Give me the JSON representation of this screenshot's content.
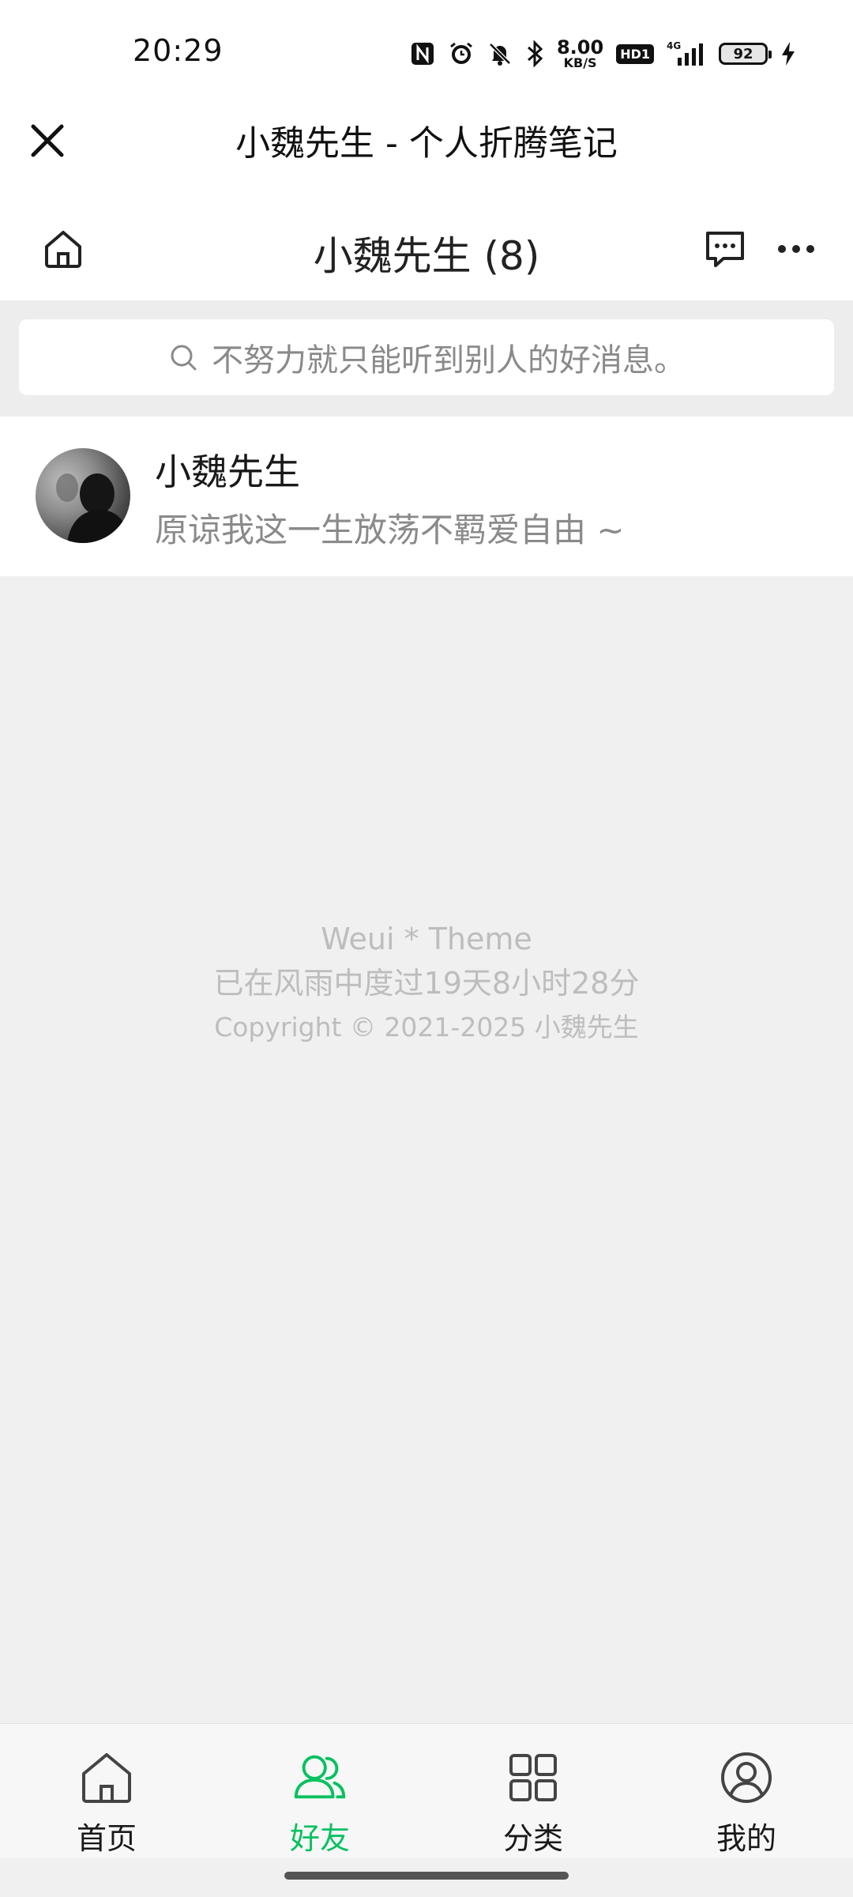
{
  "status_bar": {
    "time": "20:29",
    "net_speed_value": "8.00",
    "net_speed_unit": "KB/S",
    "hd_label": "HD1",
    "network_label": "4G",
    "battery_level": "92"
  },
  "title_bar": {
    "title": "小魏先生 - 个人折腾笔记"
  },
  "header": {
    "title": "小魏先生 (8)"
  },
  "search": {
    "placeholder": "不努力就只能听到别人的好消息。"
  },
  "friends": [
    {
      "name": "小魏先生",
      "signature": "原谅我这一生放荡不羁爱自由 ~"
    }
  ],
  "footer": {
    "theme": "Weui * Theme",
    "uptime": "已在风雨中度过19天8小时28分",
    "copyright": "Copyright © 2021-2025 小魏先生"
  },
  "tabs": [
    {
      "label": "首页",
      "icon": "home-icon",
      "active": false
    },
    {
      "label": "好友",
      "icon": "friends-icon",
      "active": true
    },
    {
      "label": "分类",
      "icon": "grid-icon",
      "active": false
    },
    {
      "label": "我的",
      "icon": "user-icon",
      "active": false
    }
  ],
  "colors": {
    "accent": "#07c160",
    "background": "#f0f0f0",
    "muted_text": "#8a8a8a"
  }
}
